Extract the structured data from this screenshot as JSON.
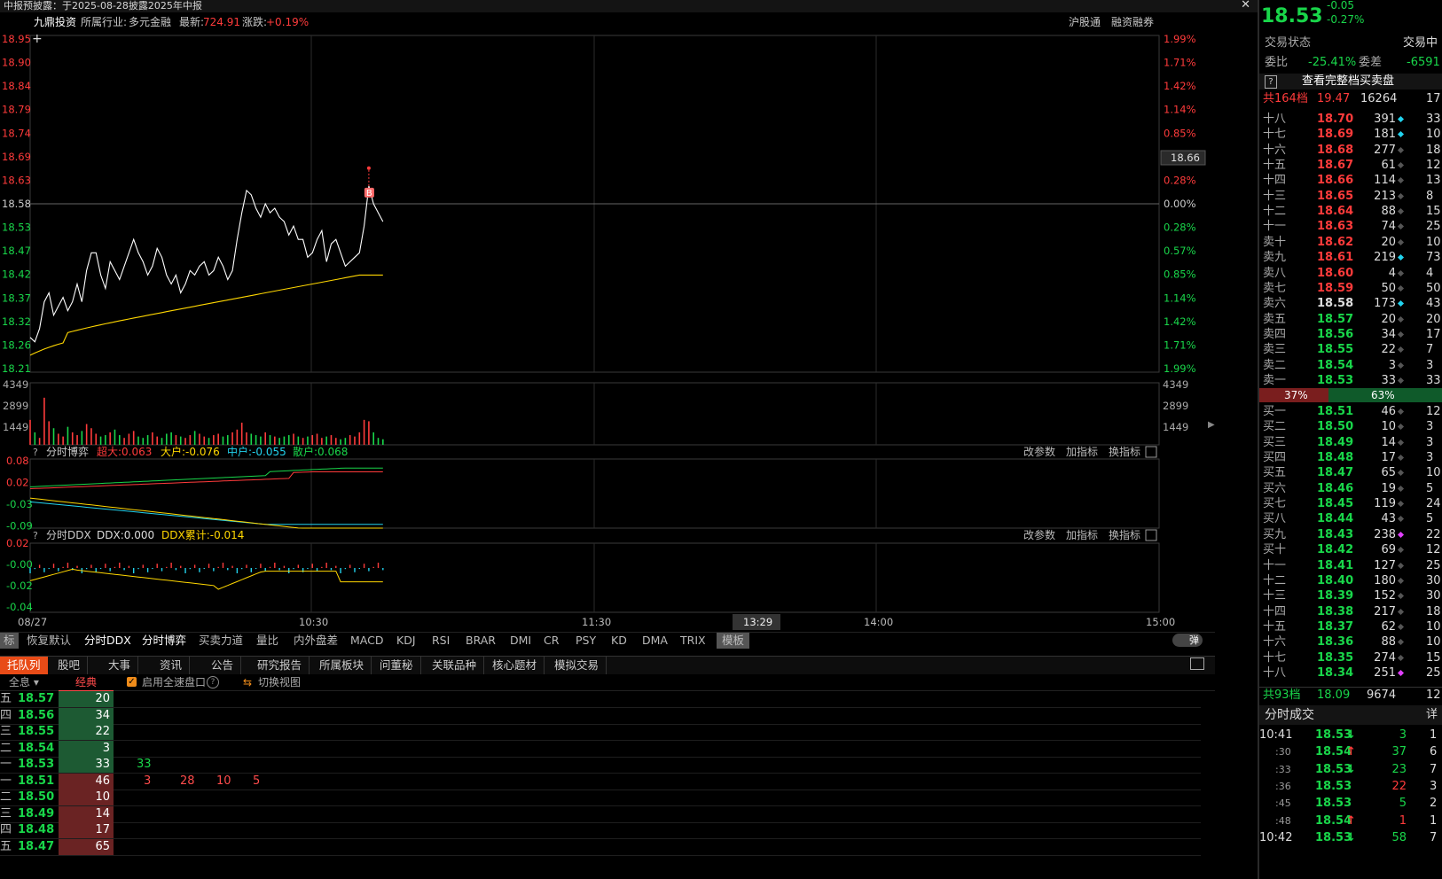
{
  "titlebar": {
    "text": "中报预披露：于2025-08-28披露2025年中报",
    "close": "✕"
  },
  "info": {
    "stock_name": "九鼎投资",
    "industry_label": "所属行业:",
    "industry_value": "多元金融",
    "latest_label": "最新:",
    "latest_value": "724.91",
    "change_label": "涨跌:",
    "change_value": "+0.19%",
    "btn1": "沪股通",
    "btn2": "融资融券"
  },
  "price_axis": {
    "left": [
      "18.95",
      "18.90",
      "18.84",
      "18.79",
      "18.74",
      "18.69",
      "18.63",
      "18.58",
      "18.53",
      "18.47",
      "18.42",
      "18.37",
      "18.32",
      "18.26",
      "18.21"
    ],
    "right": [
      "1.99%",
      "1.71%",
      "1.42%",
      "1.14%",
      "0.85%",
      "0.57%",
      "0.28%",
      "0.00%",
      "0.28%",
      "0.57%",
      "0.85%",
      "1.14%",
      "1.42%",
      "1.71%",
      "1.99%"
    ],
    "cursor_price": "18.66",
    "b_marker": "B"
  },
  "volume_axis": [
    "4349",
    "2899",
    "1449"
  ],
  "game_panel": {
    "help": "?",
    "name": "分时博弈",
    "s1": "超大:0.063",
    "s2": "大户:-0.076",
    "s3": "中户:-0.055",
    "s4": "散户:0.068",
    "axis": [
      "0.08",
      "0.02",
      "-0.03",
      "-0.09"
    ],
    "btns": [
      "改参数",
      "加指标",
      "换指标"
    ]
  },
  "ddx_panel": {
    "help": "?",
    "name": "分时DDX",
    "s1": "DDX:0.000",
    "s2": "DDX累计:-0.014",
    "axis": [
      "0.02",
      "-0.00",
      "-0.02",
      "-0.04"
    ],
    "btns": [
      "改参数",
      "加指标",
      "换指标"
    ]
  },
  "time_axis": {
    "date": "08/27",
    "labels": [
      "10:30",
      "11:30",
      "14:00",
      "15:00"
    ],
    "cursor_time": "13:29"
  },
  "indicator_tabs": [
    "标",
    "恢复默认",
    "分时DDX",
    "分时博弈",
    "买卖力道",
    "量比",
    "内外盘差",
    "MACD",
    "KDJ",
    "RSI",
    "BRAR",
    "DMI",
    "CR",
    "PSY",
    "KD",
    "DMA",
    "TRIX",
    "模板"
  ],
  "toggle_label": "弹",
  "bottom_tabs": [
    "托队列",
    "股吧",
    "大事",
    "资讯",
    "公告",
    "研究报告",
    "所属板块",
    "问董秘",
    "关联品种",
    "核心题材",
    "模拟交易"
  ],
  "queue_toolbar": {
    "all": "全息",
    "classic": "经典",
    "checkbox_label": "启用全速盘口",
    "switch_view": "切换视图"
  },
  "queue_rows": [
    {
      "lvl": "五",
      "price": "18.57",
      "vol": "20",
      "orders": []
    },
    {
      "lvl": "四",
      "price": "18.56",
      "vol": "34",
      "orders": []
    },
    {
      "lvl": "三",
      "price": "18.55",
      "vol": "22",
      "orders": []
    },
    {
      "lvl": "二",
      "price": "18.54",
      "vol": "3",
      "orders": []
    },
    {
      "lvl": "一",
      "price": "18.53",
      "vol": "33",
      "orders": [
        "33"
      ]
    },
    {
      "lvl": "一",
      "price": "18.51",
      "vol": "46",
      "orders": [
        "3",
        "28",
        "10",
        "5"
      ]
    },
    {
      "lvl": "二",
      "price": "18.50",
      "vol": "10",
      "orders": []
    },
    {
      "lvl": "三",
      "price": "18.49",
      "vol": "14",
      "orders": []
    },
    {
      "lvl": "四",
      "price": "18.48",
      "vol": "17",
      "orders": []
    },
    {
      "lvl": "五",
      "price": "18.47",
      "vol": "65",
      "orders": []
    }
  ],
  "right": {
    "price": "18.53",
    "change": "-0.05",
    "change_pct": "-0.27%",
    "status_label": "交易状态",
    "status_value": "交易中",
    "weibi_label": "委比",
    "weibi_value": "-25.41%",
    "weicha_label": "委差",
    "weicha_value": "-6591",
    "full_book": "查看完整档买卖盘",
    "sell_total_label": "共164档",
    "sell_total_price": "19.47",
    "sell_total_vol": "16264",
    "sell_total_extra": "17",
    "sells": [
      {
        "l": "十八",
        "p": "18.70",
        "v": "391",
        "d": "cyan",
        "e": "33"
      },
      {
        "l": "十七",
        "p": "18.69",
        "v": "181",
        "d": "cyan",
        "e": "10"
      },
      {
        "l": "十六",
        "p": "18.68",
        "v": "277",
        "d": "gray",
        "e": "18"
      },
      {
        "l": "十五",
        "p": "18.67",
        "v": "61",
        "d": "gray",
        "e": "12"
      },
      {
        "l": "十四",
        "p": "18.66",
        "v": "114",
        "d": "gray",
        "e": "13"
      },
      {
        "l": "十三",
        "p": "18.65",
        "v": "213",
        "d": "gray",
        "e": "8"
      },
      {
        "l": "十二",
        "p": "18.64",
        "v": "88",
        "d": "gray",
        "e": "15"
      },
      {
        "l": "十一",
        "p": "18.63",
        "v": "74",
        "d": "gray",
        "e": "25"
      },
      {
        "l": "卖十",
        "p": "18.62",
        "v": "20",
        "d": "gray",
        "e": "10"
      },
      {
        "l": "卖九",
        "p": "18.61",
        "v": "219",
        "d": "cyan",
        "e": "73"
      },
      {
        "l": "卖八",
        "p": "18.60",
        "v": "4",
        "d": "gray",
        "e": "4"
      },
      {
        "l": "卖七",
        "p": "18.59",
        "v": "50",
        "d": "gray",
        "e": "50"
      },
      {
        "l": "卖六",
        "p": "18.58",
        "v": "173",
        "d": "cyan",
        "e": "43"
      },
      {
        "l": "卖五",
        "p": "18.57",
        "v": "20",
        "d": "gray",
        "e": "20"
      },
      {
        "l": "卖四",
        "p": "18.56",
        "v": "34",
        "d": "gray",
        "e": "17"
      },
      {
        "l": "卖三",
        "p": "18.55",
        "v": "22",
        "d": "gray",
        "e": "7"
      },
      {
        "l": "卖二",
        "p": "18.54",
        "v": "3",
        "d": "gray",
        "e": "3"
      },
      {
        "l": "卖一",
        "p": "18.53",
        "v": "33",
        "d": "gray",
        "e": "33"
      }
    ],
    "ratio_sell": "37%",
    "ratio_buy": "63%",
    "buys": [
      {
        "l": "买一",
        "p": "18.51",
        "v": "46",
        "d": "gray",
        "e": "12"
      },
      {
        "l": "买二",
        "p": "18.50",
        "v": "10",
        "d": "gray",
        "e": "3"
      },
      {
        "l": "买三",
        "p": "18.49",
        "v": "14",
        "d": "gray",
        "e": "3"
      },
      {
        "l": "买四",
        "p": "18.48",
        "v": "17",
        "d": "gray",
        "e": "3"
      },
      {
        "l": "买五",
        "p": "18.47",
        "v": "65",
        "d": "gray",
        "e": "10"
      },
      {
        "l": "买六",
        "p": "18.46",
        "v": "19",
        "d": "gray",
        "e": "5"
      },
      {
        "l": "买七",
        "p": "18.45",
        "v": "119",
        "d": "gray",
        "e": "24"
      },
      {
        "l": "买八",
        "p": "18.44",
        "v": "43",
        "d": "gray",
        "e": "5"
      },
      {
        "l": "买九",
        "p": "18.43",
        "v": "238",
        "d": "magenta",
        "e": "22"
      },
      {
        "l": "买十",
        "p": "18.42",
        "v": "69",
        "d": "gray",
        "e": "12"
      },
      {
        "l": "十一",
        "p": "18.41",
        "v": "127",
        "d": "gray",
        "e": "25"
      },
      {
        "l": "十二",
        "p": "18.40",
        "v": "180",
        "d": "gray",
        "e": "30"
      },
      {
        "l": "十三",
        "p": "18.39",
        "v": "152",
        "d": "gray",
        "e": "30"
      },
      {
        "l": "十四",
        "p": "18.38",
        "v": "217",
        "d": "gray",
        "e": "18"
      },
      {
        "l": "十五",
        "p": "18.37",
        "v": "62",
        "d": "gray",
        "e": "10"
      },
      {
        "l": "十六",
        "p": "18.36",
        "v": "88",
        "d": "gray",
        "e": "10"
      },
      {
        "l": "十七",
        "p": "18.35",
        "v": "274",
        "d": "gray",
        "e": "15"
      },
      {
        "l": "十八",
        "p": "18.34",
        "v": "251",
        "d": "magenta",
        "e": "25"
      }
    ],
    "buy_total_label": "共93档",
    "buy_total_price": "18.09",
    "buy_total_vol": "9674",
    "buy_total_extra": "12",
    "ticks_title": "分时成交",
    "ticks_more": "详",
    "ticks": [
      {
        "t": "10:41",
        "p": "18.53",
        "dir": "down",
        "v": "3",
        "vc": "green",
        "e": "1"
      },
      {
        "t": ":30",
        "p": "18.54",
        "dir": "up",
        "v": "37",
        "vc": "green",
        "e": "6"
      },
      {
        "t": ":33",
        "p": "18.53",
        "dir": "down",
        "v": "23",
        "vc": "green",
        "e": "7"
      },
      {
        "t": ":36",
        "p": "18.53",
        "dir": "",
        "v": "22",
        "vc": "red",
        "e": "3"
      },
      {
        "t": ":45",
        "p": "18.53",
        "dir": "",
        "v": "5",
        "vc": "green",
        "e": "2"
      },
      {
        "t": ":48",
        "p": "18.54",
        "dir": "up",
        "v": "1",
        "vc": "red",
        "e": "1"
      },
      {
        "t": "10:42",
        "p": "18.53",
        "dir": "down",
        "v": "58",
        "vc": "green",
        "e": "7"
      }
    ]
  },
  "colors": {
    "up": "#ff3b3b",
    "down": "#19d64a",
    "avg": "#ffd700",
    "price_line": "#ffffff",
    "cyan": "#22d3ee",
    "magenta": "#e040fb"
  }
}
